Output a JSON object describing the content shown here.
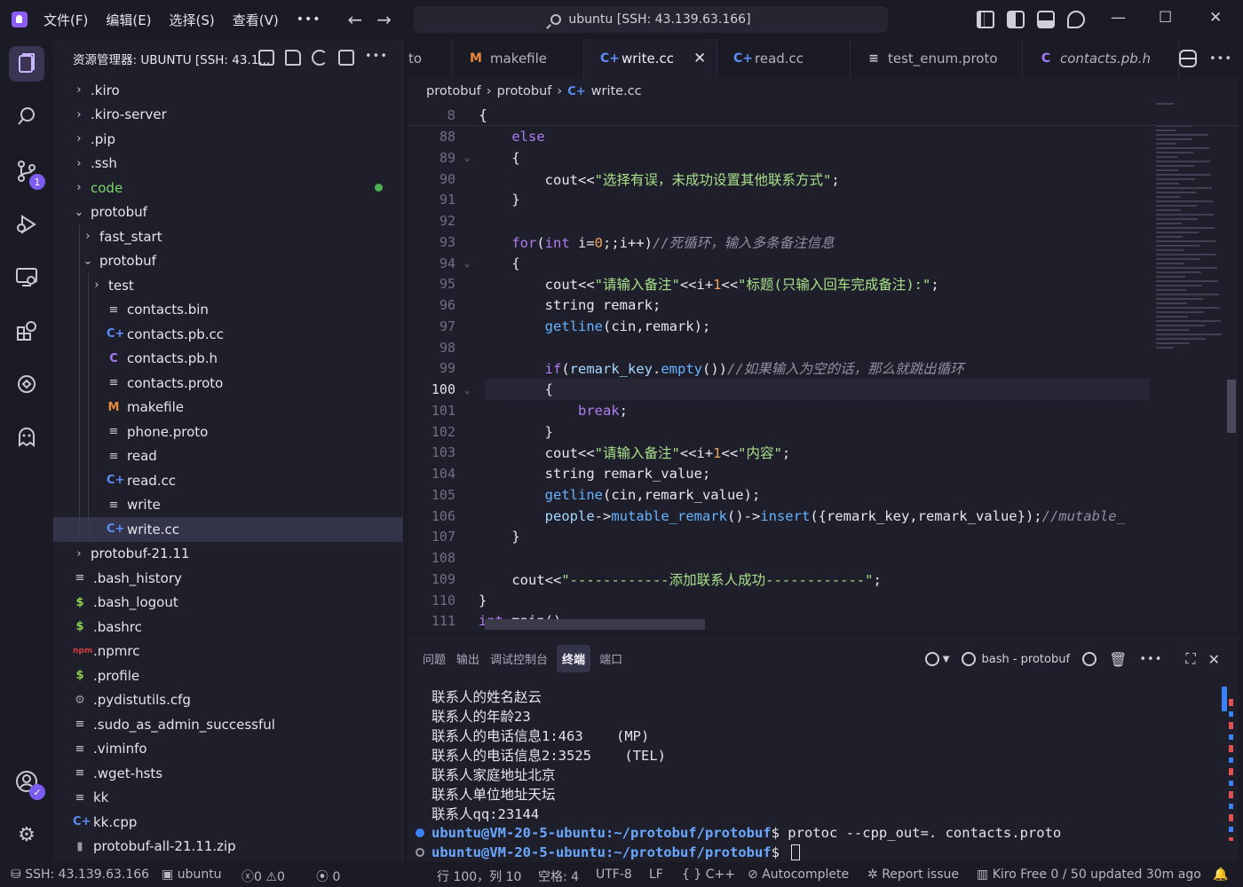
{
  "menu": {
    "items": [
      "文件(F)",
      "编辑(E)",
      "选择(S)",
      "查看(V)"
    ],
    "more": "•••"
  },
  "command_center": {
    "label": "ubuntu [SSH: 43.139.63.166]"
  },
  "activity_bar": {
    "source_control_badge": "1"
  },
  "sidebar": {
    "title": "资源管理器: UBUNTU [SSH: 43.1...",
    "more": "•••",
    "tree": [
      {
        "label": ".kiro",
        "type": "folder",
        "depth": 0,
        "expanded": false
      },
      {
        "label": ".kiro-server",
        "type": "folder",
        "depth": 0,
        "expanded": false
      },
      {
        "label": ".pip",
        "type": "folder",
        "depth": 0,
        "expanded": false
      },
      {
        "label": ".ssh",
        "type": "folder",
        "depth": 0,
        "expanded": false
      },
      {
        "label": "code",
        "type": "folder",
        "depth": 0,
        "expanded": false,
        "modified": true
      },
      {
        "label": "protobuf",
        "type": "folder",
        "depth": 0,
        "expanded": true
      },
      {
        "label": "fast_start",
        "type": "folder",
        "depth": 1,
        "expanded": false
      },
      {
        "label": "protobuf",
        "type": "folder",
        "depth": 1,
        "expanded": true
      },
      {
        "label": "test",
        "type": "folder",
        "depth": 2,
        "expanded": false
      },
      {
        "label": "contacts.bin",
        "type": "txt",
        "depth": 2
      },
      {
        "label": "contacts.pb.cc",
        "type": "cc",
        "depth": 2
      },
      {
        "label": "contacts.pb.h",
        "type": "h",
        "depth": 2
      },
      {
        "label": "contacts.proto",
        "type": "txt",
        "depth": 2
      },
      {
        "label": "makefile",
        "type": "m",
        "depth": 2
      },
      {
        "label": "phone.proto",
        "type": "txt",
        "depth": 2
      },
      {
        "label": "read",
        "type": "txt",
        "depth": 2
      },
      {
        "label": "read.cc",
        "type": "cc",
        "depth": 2
      },
      {
        "label": "write",
        "type": "txt",
        "depth": 2
      },
      {
        "label": "write.cc",
        "type": "cc",
        "depth": 2,
        "selected": true
      },
      {
        "label": "protobuf-21.11",
        "type": "folder",
        "depth": 0,
        "expanded": false
      },
      {
        "label": ".bash_history",
        "type": "txt",
        "depth": 0
      },
      {
        "label": ".bash_logout",
        "type": "sh",
        "depth": 0
      },
      {
        "label": ".bashrc",
        "type": "sh",
        "depth": 0
      },
      {
        "label": ".npmrc",
        "type": "npm",
        "depth": 0
      },
      {
        "label": ".profile",
        "type": "sh",
        "depth": 0
      },
      {
        "label": ".pydistutils.cfg",
        "type": "gear",
        "depth": 0
      },
      {
        "label": ".sudo_as_admin_successful",
        "type": "txt",
        "depth": 0
      },
      {
        "label": ".viminfo",
        "type": "txt",
        "depth": 0
      },
      {
        "label": ".wget-hsts",
        "type": "txt",
        "depth": 0
      },
      {
        "label": "kk",
        "type": "txt",
        "depth": 0
      },
      {
        "label": "kk.cpp",
        "type": "cc",
        "depth": 0
      },
      {
        "label": "protobuf-all-21.11.zip",
        "type": "zip",
        "depth": 0
      }
    ]
  },
  "tabs": [
    {
      "label": "to",
      "icon": "",
      "partial": true
    },
    {
      "label": "makefile",
      "icon": "M",
      "icon_type": "m"
    },
    {
      "label": "write.cc",
      "icon": "C+",
      "icon_type": "cc",
      "active": true
    },
    {
      "label": "read.cc",
      "icon": "C+",
      "icon_type": "cc"
    },
    {
      "label": "test_enum.proto",
      "icon": "≡",
      "icon_type": "txt"
    },
    {
      "label": "contacts.pb.h",
      "icon": "C",
      "icon_type": "h",
      "italic": true
    }
  ],
  "breadcrumb": [
    "protobuf",
    "protobuf",
    "write.cc"
  ],
  "editor": {
    "sticky": {
      "num": "8",
      "text": "{"
    },
    "lines": [
      {
        "num": "88",
        "fold": "",
        "tokens": [
          [
            "    ",
            ""
          ],
          [
            "else",
            "kw"
          ]
        ]
      },
      {
        "num": "89",
        "fold": "v",
        "tokens": [
          [
            "    {",
            ""
          ]
        ]
      },
      {
        "num": "90",
        "fold": "",
        "tokens": [
          [
            "        cout<<",
            ""
          ],
          [
            "\"选择有误，未成功设置其他联系方式\"",
            "str"
          ],
          [
            ";",
            ""
          ]
        ]
      },
      {
        "num": "91",
        "fold": "",
        "tokens": [
          [
            "    }",
            ""
          ]
        ]
      },
      {
        "num": "92",
        "fold": "",
        "tokens": [
          [
            "",
            ""
          ]
        ]
      },
      {
        "num": "93",
        "fold": "",
        "tokens": [
          [
            "    ",
            ""
          ],
          [
            "for",
            "kw"
          ],
          [
            "(",
            ""
          ],
          [
            "int",
            "ty"
          ],
          [
            " i=",
            ""
          ],
          [
            "0",
            "num"
          ],
          [
            ";;i++)",
            ""
          ],
          [
            "//死循环，输入多条备注信息",
            "cm"
          ]
        ]
      },
      {
        "num": "94",
        "fold": "v",
        "tokens": [
          [
            "    {",
            ""
          ]
        ]
      },
      {
        "num": "95",
        "fold": "",
        "tokens": [
          [
            "        cout<<",
            ""
          ],
          [
            "\"请输入备注\"",
            "str"
          ],
          [
            "<<i+",
            ""
          ],
          [
            "1",
            "num"
          ],
          [
            "<<",
            ""
          ],
          [
            "\"标题(只输入回车完成备注):\"",
            "str"
          ],
          [
            ";",
            ""
          ]
        ]
      },
      {
        "num": "96",
        "fold": "",
        "tokens": [
          [
            "        string remark;",
            ""
          ]
        ]
      },
      {
        "num": "97",
        "fold": "",
        "tokens": [
          [
            "        ",
            ""
          ],
          [
            "getline",
            "fn"
          ],
          [
            "(cin,remark);",
            ""
          ]
        ]
      },
      {
        "num": "98",
        "fold": "",
        "tokens": [
          [
            "",
            ""
          ]
        ]
      },
      {
        "num": "99",
        "fold": "",
        "tokens": [
          [
            "        ",
            ""
          ],
          [
            "if",
            "kw"
          ],
          [
            "(",
            ""
          ],
          [
            "remark_key",
            "id"
          ],
          [
            ".",
            ""
          ],
          [
            "empty",
            "fn"
          ],
          [
            "())",
            ""
          ],
          [
            "//如果输入为空的话，那么就跳出循环",
            "cm"
          ]
        ]
      },
      {
        "num": "100",
        "fold": "v",
        "current": true,
        "tokens": [
          [
            "        {",
            ""
          ]
        ]
      },
      {
        "num": "101",
        "fold": "",
        "tokens": [
          [
            "            ",
            ""
          ],
          [
            "break",
            "kw"
          ],
          [
            ";",
            ""
          ]
        ]
      },
      {
        "num": "102",
        "fold": "",
        "tokens": [
          [
            "        }",
            ""
          ]
        ]
      },
      {
        "num": "103",
        "fold": "",
        "tokens": [
          [
            "        cout<<",
            ""
          ],
          [
            "\"请输入备注\"",
            "str"
          ],
          [
            "<<i+",
            ""
          ],
          [
            "1",
            "num"
          ],
          [
            "<<",
            ""
          ],
          [
            "\"内容\"",
            "str"
          ],
          [
            ";",
            ""
          ]
        ]
      },
      {
        "num": "104",
        "fold": "",
        "tokens": [
          [
            "        string remark_value;",
            ""
          ]
        ]
      },
      {
        "num": "105",
        "fold": "",
        "tokens": [
          [
            "        ",
            ""
          ],
          [
            "getline",
            "fn"
          ],
          [
            "(cin,remark_value);",
            ""
          ]
        ]
      },
      {
        "num": "106",
        "fold": "",
        "tokens": [
          [
            "        ",
            ""
          ],
          [
            "people",
            "id"
          ],
          [
            "->",
            ""
          ],
          [
            "mutable_remark",
            "fn"
          ],
          [
            "()->",
            ""
          ],
          [
            "insert",
            "fn"
          ],
          [
            "({remark_key,remark_value});",
            ""
          ],
          [
            "//mutable_",
            "cm"
          ]
        ]
      },
      {
        "num": "107",
        "fold": "",
        "tokens": [
          [
            "    }",
            ""
          ]
        ]
      },
      {
        "num": "108",
        "fold": "",
        "tokens": [
          [
            "",
            ""
          ]
        ]
      },
      {
        "num": "109",
        "fold": "",
        "tokens": [
          [
            "    cout<<",
            ""
          ],
          [
            "\"------------添加联系人成功------------\"",
            "str"
          ],
          [
            ";",
            ""
          ]
        ]
      },
      {
        "num": "110",
        "fold": "",
        "tokens": [
          [
            "}",
            ""
          ]
        ]
      },
      {
        "num": "111",
        "fold": "",
        "tokens": [
          [
            "int",
            "ty"
          ],
          [
            " main()",
            ""
          ]
        ]
      }
    ]
  },
  "panel": {
    "tabs": [
      "问题",
      "输出",
      "调试控制台",
      "终端",
      "端口"
    ],
    "active_tab": "终端",
    "terminal_name": "bash - protobuf",
    "more": "•••",
    "terminal_lines": [
      "联系人的姓名赵云",
      "联系人的年龄23",
      "联系人的电话信息1:463    (MP)",
      "联系人的电话信息2:3525    (TEL)",
      "联系人家庭地址北京",
      "联系人单位地址天坛",
      "联系人qq:23144"
    ],
    "prompts": [
      {
        "user": "ubuntu@VM-20-5-ubuntu",
        "path": ":~/protobuf/protobuf",
        "symbol": "$ ",
        "command": "protoc --cpp_out=. contacts.proto",
        "status_color": "#3b82f6"
      },
      {
        "user": "ubuntu@VM-20-5-ubuntu",
        "path": ":~/protobuf/protobuf",
        "symbol": "$ ",
        "command": "",
        "status_color": "#9a9aa8"
      }
    ]
  },
  "statusbar": {
    "remote": "SSH: 43.139.63.166",
    "host": "ubuntu",
    "errors": "0",
    "warnings": "0",
    "ports": "0",
    "position": "行 100，列 10",
    "spaces": "空格: 4",
    "encoding": "UTF-8",
    "eol": "LF",
    "language": "{ } C++",
    "autocomplete": "Autocomplete",
    "report": "Report issue",
    "kiro": "Kiro Free 0 / 50 updated 30m ago"
  },
  "colors": {
    "accent": "#7c5cf0",
    "background": "#1f1f2b",
    "keyword": "#b07cf0",
    "string": "#a8e08a",
    "function": "#66b3ff"
  }
}
